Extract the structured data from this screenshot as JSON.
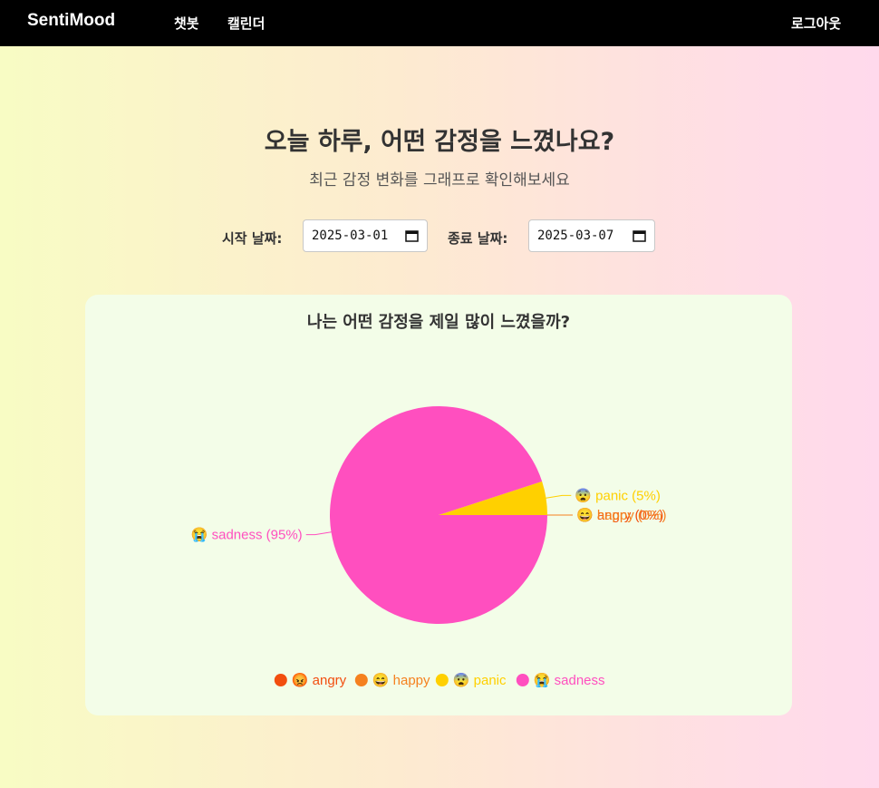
{
  "nav": {
    "brand": "SentiMood",
    "chatbot": "챗봇",
    "calendar": "캘린더",
    "logout": "로그아웃"
  },
  "header": {
    "title": "오늘 하루, 어떤 감정을 느꼈나요?",
    "subtitle": "최근 감정 변화를 그래프로 확인해보세요"
  },
  "filters": {
    "start_label": "시작 날짜:",
    "start_value": "2025-03-01",
    "end_label": "종료 날짜:",
    "end_value": "2025-03-07"
  },
  "chart_data": {
    "type": "pie",
    "title": "나는 어떤 감정을 제일 많이 느꼈을까?",
    "legend_position": "bottom",
    "slices": [
      {
        "name": "angry",
        "emoji": "😡",
        "value": 0,
        "color": "#f24e0f"
      },
      {
        "name": "happy",
        "emoji": "😄",
        "value": 0,
        "color": "#f5811f"
      },
      {
        "name": "panic",
        "emoji": "😨",
        "value": 5,
        "color": "#ffd000"
      },
      {
        "name": "sadness",
        "emoji": "😭",
        "value": 95,
        "color": "#ff4fbf"
      }
    ]
  }
}
